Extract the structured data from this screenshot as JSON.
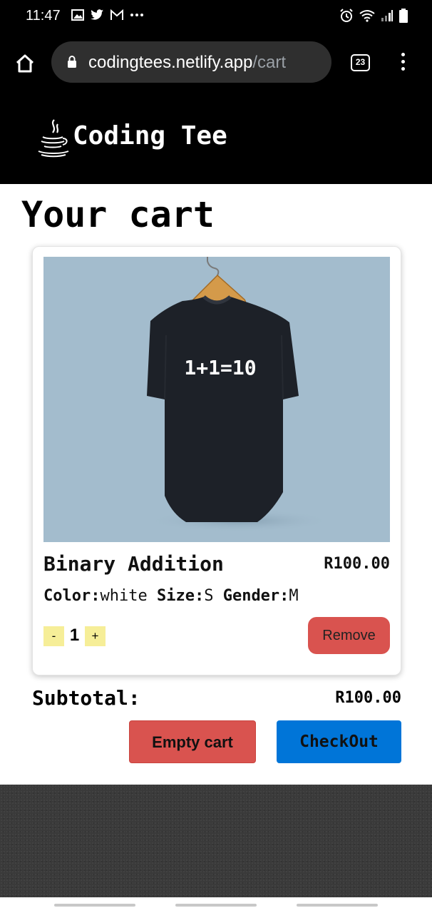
{
  "status_bar": {
    "time": "11:47",
    "left_icons": [
      "gallery-icon",
      "twitter-icon",
      "gmail-icon",
      "more-dots-icon"
    ],
    "right_icons": [
      "alarm-icon",
      "wifi-icon",
      "signal-icon",
      "battery-icon"
    ]
  },
  "browser": {
    "url_domain": "codingtees.netlify.app",
    "url_path": "/cart",
    "tab_count": "23"
  },
  "header": {
    "logo_text": "Coding Tee"
  },
  "page": {
    "title": "Your cart"
  },
  "cart": {
    "items": [
      {
        "name": "Binary Addition",
        "price": "R100.00",
        "shirt_print": "1+1=10",
        "color_label": "Color:",
        "color_value": "white",
        "size_label": "Size:",
        "size_value": "S",
        "gender_label": "Gender:",
        "gender_value": "M",
        "qty_minus": "-",
        "qty_plus": "+",
        "quantity": "1",
        "remove_label": "Remove"
      }
    ],
    "subtotal_label": "Subtotal:",
    "subtotal_value": "R100.00",
    "empty_label": "Empty cart",
    "checkout_label": "CheckOut"
  },
  "colors": {
    "danger": "#d9534f",
    "primary": "#0075d8",
    "qty_bg": "#f6ee98",
    "image_bg": "#a3bccd"
  }
}
